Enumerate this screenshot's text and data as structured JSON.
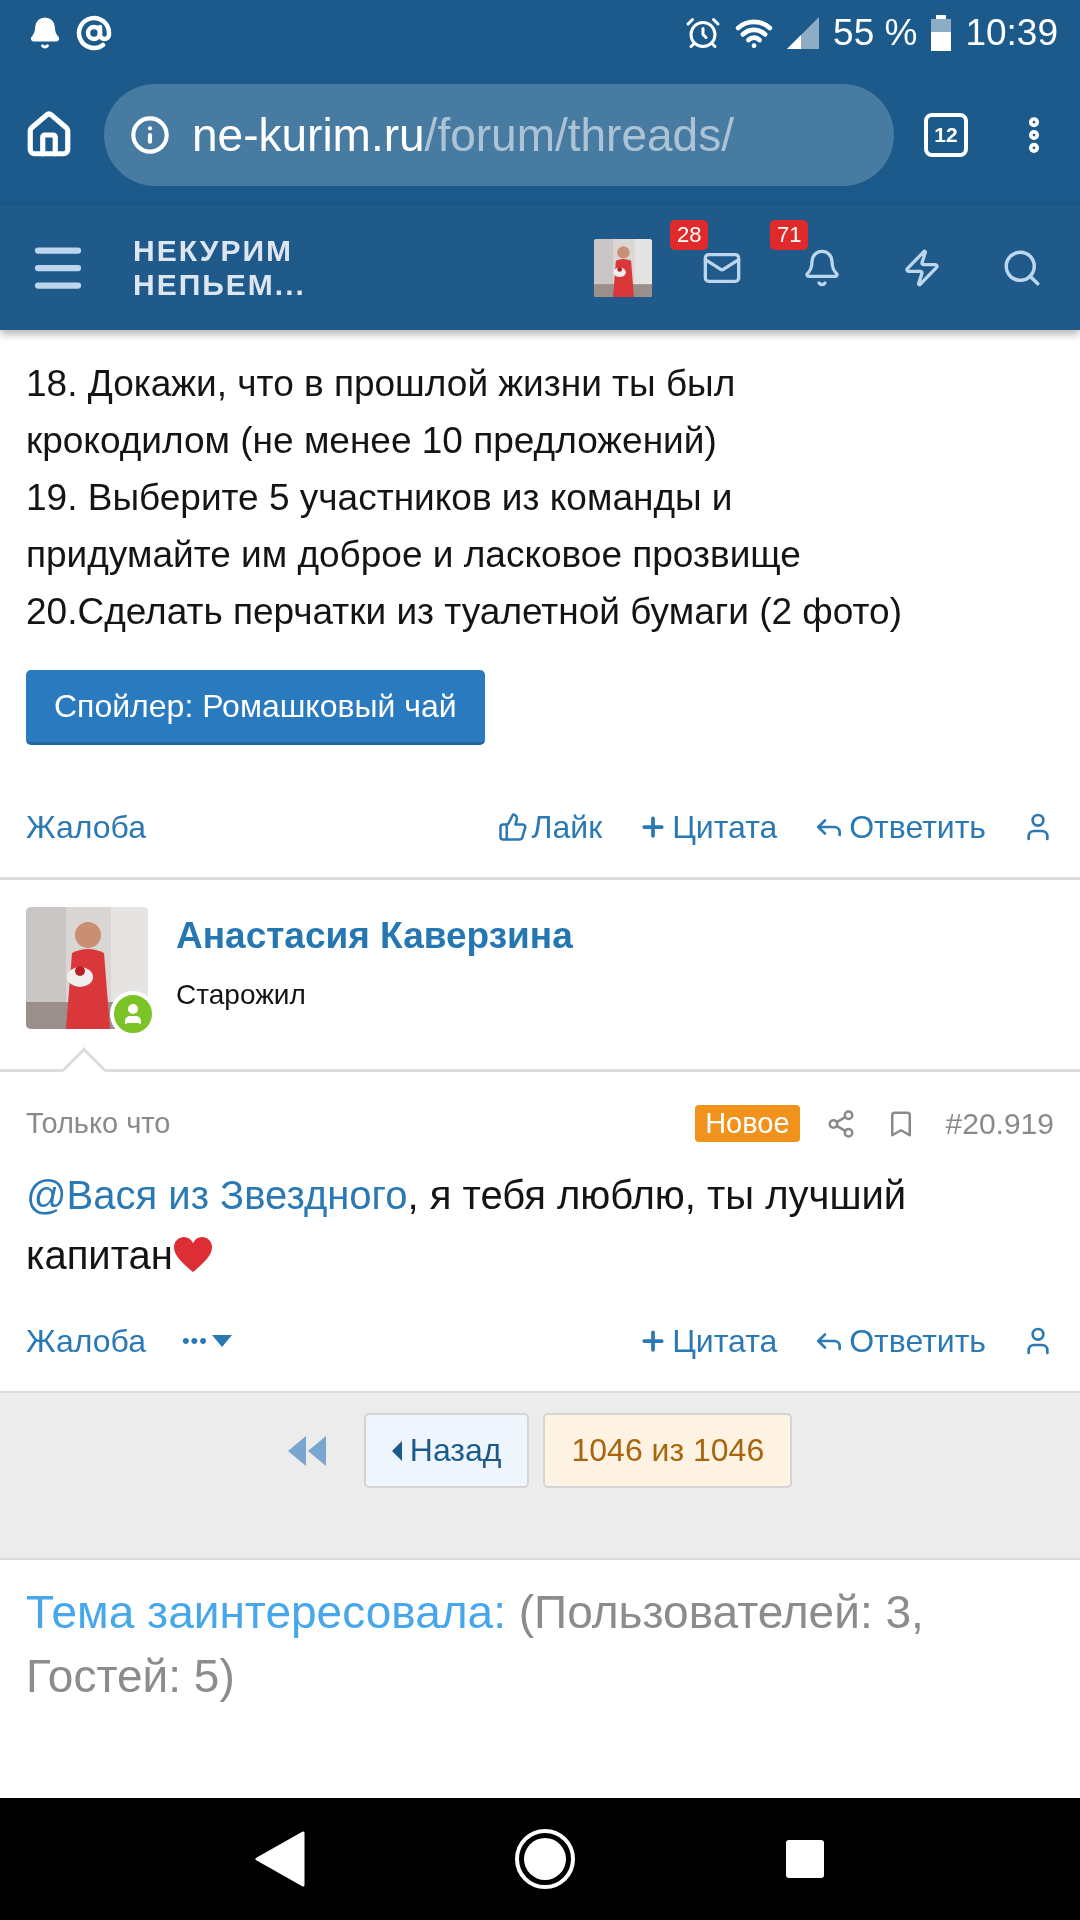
{
  "status_bar": {
    "battery": "55 %",
    "time": "10:39"
  },
  "browser": {
    "url_host": "ne-kurim.ru",
    "url_path": "/forum/threads/",
    "tab_count": "12"
  },
  "forum_header": {
    "logo_lines": [
      "НЕКУРИМ",
      "НЕПЬЕМ..."
    ],
    "inbox_badge": "28",
    "alerts_badge": "71"
  },
  "previous_post": {
    "lines": [
      "18. Докажи, что в прошлой жизни ты был",
      "крокодилом (не менее 10 предложений)",
      "19. Выберите 5 участников из команды и",
      "придумайте им доброе и ласковое прозвище",
      "20.Сделать перчатки из туалетной бумаги (2 фото)"
    ],
    "spoiler_button": "Спойлер: Ромашковый чай",
    "actions_left": [
      {
        "kind": "report",
        "label": "Жалоба"
      }
    ],
    "actions_right": [
      {
        "kind": "like",
        "label": "Лайк"
      },
      {
        "kind": "quote",
        "label": "Цитата"
      },
      {
        "kind": "reply",
        "label": "Ответить"
      },
      {
        "kind": "user"
      }
    ]
  },
  "post": {
    "author": "Анастасия Каверзина",
    "role": "Старожил",
    "online": true,
    "time": "Только что",
    "badge": "Новое",
    "number": "#20.919",
    "mention": "@Вася из Звездного",
    "message": ", я тебя люблю, ты лучший капитан",
    "actions_left": [
      {
        "kind": "report",
        "label": "Жалоба"
      },
      {
        "kind": "more",
        "label": "•••"
      }
    ],
    "actions_right": [
      {
        "kind": "quote",
        "label": "Цитата"
      },
      {
        "kind": "reply",
        "label": "Ответить"
      },
      {
        "kind": "user"
      }
    ]
  },
  "pagination": {
    "back": "Назад",
    "current": "1046 из 1046"
  },
  "interested": {
    "label": "Тема заинтересовала:",
    "counts": "(Пользователей: 3, Гостей: 5)"
  }
}
